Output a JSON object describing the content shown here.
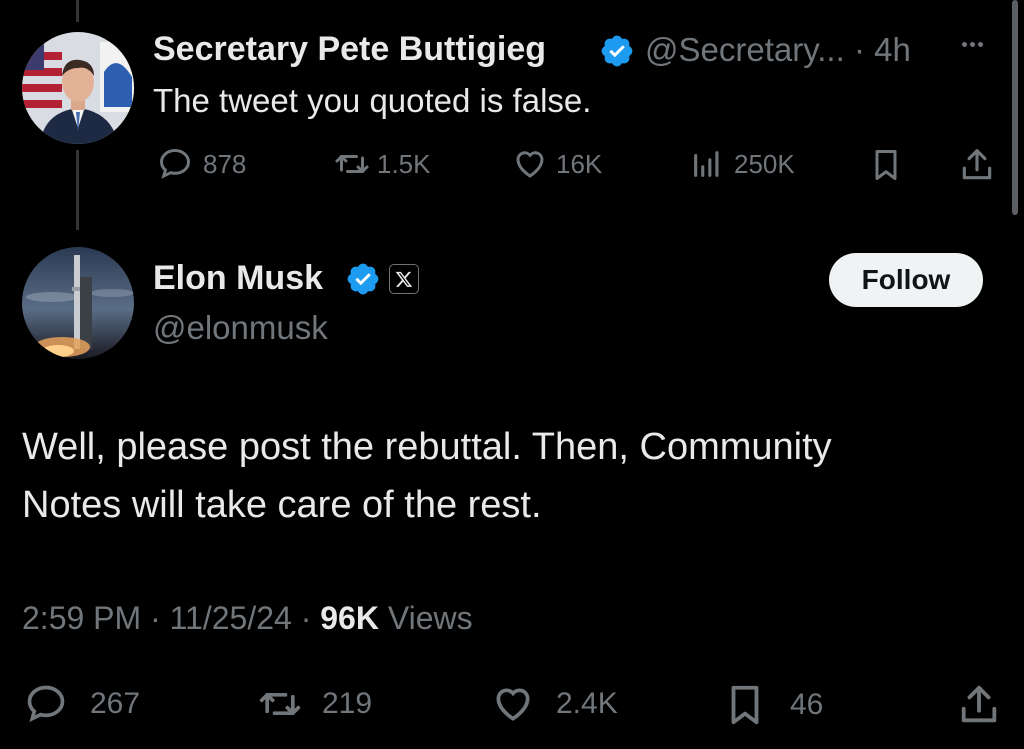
{
  "quoted_tweet": {
    "display_name": "Secretary Pete Buttigieg",
    "handle_time": "@Secretary... · 4h",
    "text": "The tweet you quoted is false.",
    "actions": {
      "replies": "878",
      "reposts": "1.5K",
      "likes": "16K",
      "views": "250K"
    }
  },
  "reply_tweet": {
    "display_name": "Elon Musk",
    "handle": "@elonmusk",
    "follow_label": "Follow",
    "text_line1": "Well, please post the rebuttal. Then, Community",
    "text_line2": "Notes will take care of the rest.",
    "time": "2:59 PM",
    "date": "11/25/24",
    "views_count": "96K",
    "views_label": "Views",
    "actions": {
      "replies": "267",
      "reposts": "219",
      "likes": "2.4K",
      "bookmarks": "46"
    }
  },
  "colors": {
    "background": "#000000",
    "primary_text": "#e7e9ea",
    "secondary_text": "#71767b",
    "verified": "#1d9bf0"
  },
  "icons": [
    "reply-icon",
    "repost-icon",
    "like-icon",
    "views-icon",
    "bookmark-icon",
    "share-icon",
    "verified-icon",
    "x-logo-icon",
    "more-icon"
  ]
}
